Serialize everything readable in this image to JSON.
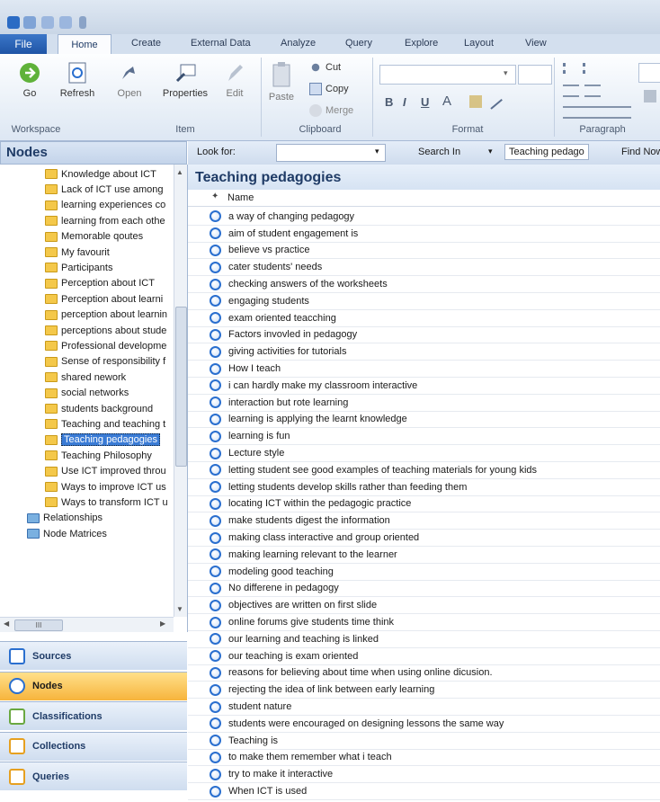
{
  "ribbon": {
    "tabs": [
      "File",
      "Home",
      "Create",
      "External Data",
      "Analyze",
      "Query",
      "Explore",
      "Layout",
      "View"
    ],
    "buttons": {
      "go": "Go",
      "refresh": "Refresh",
      "open": "Open",
      "properties": "Properties",
      "edit": "Edit",
      "paste": "Paste",
      "cut": "Cut",
      "copy": "Copy",
      "merge": "Merge"
    },
    "groups": {
      "workspace": "Workspace",
      "item": "Item",
      "clipboard": "Clipboard",
      "format": "Format",
      "paragraph": "Paragraph"
    },
    "format_buttons": {
      "bold": "B",
      "italic": "I",
      "underline": "U",
      "font_color": "A"
    }
  },
  "left_panel": {
    "title": "Nodes",
    "tree": [
      "Knowledge about ICT",
      "Lack of ICT use among",
      "learning experiences co",
      "learning from each othe",
      "Memorable qoutes",
      "My favourit",
      "Participants",
      "Perception about ICT",
      "Perception about learni",
      "perception about learnin",
      "perceptions about stude",
      "Professional developme",
      "Sense of responsibility f",
      "shared nework",
      "social networks",
      "students background",
      "Teaching and teaching t",
      "Teaching pedagogies",
      "Teaching Philosophy",
      "Use ICT improved throu",
      "Ways to improve ICT us",
      "Ways to transform ICT u"
    ],
    "selected_index": 17,
    "top_level": [
      "Relationships",
      "Node Matrices"
    ],
    "hscroll_label": "III"
  },
  "nav": [
    "Sources",
    "Nodes",
    "Classifications",
    "Collections",
    "Queries"
  ],
  "nav_active": "Nodes",
  "findbar": {
    "look_for_label": "Look for:",
    "look_for_value": "",
    "search_in_label": "Search In",
    "search_in_value": "Teaching pedago",
    "find_now": "Find Now"
  },
  "list": {
    "title": "Teaching pedagogies",
    "column": "Name",
    "rows": [
      "a way of changing pedagogy",
      "aim of student engagement is",
      "believe vs practice",
      "cater students' needs",
      "checking answers of the worksheets",
      "engaging students",
      "exam oriented teacching",
      "Factors invovled in pedagogy",
      "giving activities for tutorials",
      "How I teach",
      "i can hardly make my classroom interactive",
      "interaction but rote learning",
      "learning is applying the learnt knowledge",
      "learning is fun",
      "Lecture style",
      "letting student see good examples of teaching materials for young kids",
      "letting students develop skills rather than feeding them",
      "locating ICT within the pedagogic practice",
      "make students digest the information",
      "making class interactive and group oriented",
      "making learning relevant to the learner",
      "modeling good teaching",
      "No differene in pedagogy",
      "objectives are written on first slide",
      "online forums give students time think",
      "our learning and teaching is linked",
      "our teaching is exam oriented",
      "reasons for believing about time when using online dicusion.",
      "rejecting the idea of link between early learning",
      "student nature",
      "students were encouraged on designing lessons the same way",
      "Teaching is",
      "to make them remember what i teach",
      "try to make it interactive",
      "When ICT is used"
    ]
  },
  "colors": {
    "accent": "#3a7bd5",
    "nav_active": "#f7b43c",
    "header": "#1f3b66"
  }
}
